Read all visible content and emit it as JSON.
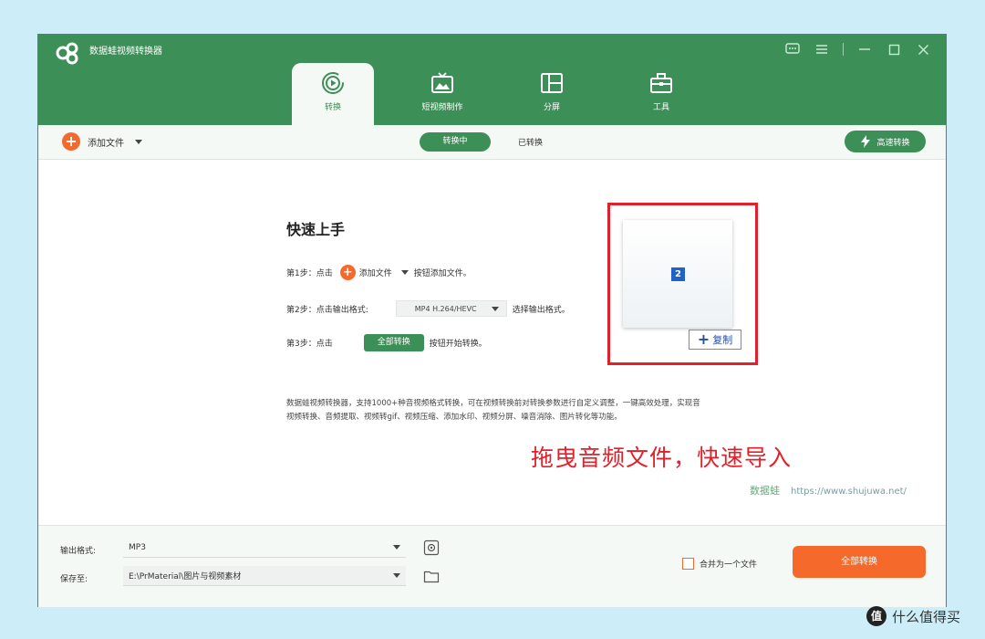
{
  "app": {
    "title": "数据蛙视频转换器"
  },
  "tabs": [
    {
      "label": "转换",
      "icon": "convert-icon",
      "active": true
    },
    {
      "label": "短视频制作",
      "icon": "tv-icon",
      "active": false
    },
    {
      "label": "分屏",
      "icon": "split-screen-icon",
      "active": false
    },
    {
      "label": "工具",
      "icon": "toolbox-icon",
      "active": false
    }
  ],
  "toolbar": {
    "add_file": "添加文件",
    "converting": "转换中",
    "converted": "已转换",
    "high_speed": "高速转换"
  },
  "guide": {
    "title": "快速上手",
    "step1_prefix": "第1步：点击",
    "step1_button": "添加文件",
    "step1_suffix": "按钮添加文件。",
    "step2_prefix": "第2步：点击输出格式:",
    "step2_format": "MP4 H.264/HEVC",
    "step2_suffix": "选择输出格式。",
    "step3_prefix": "第3步：点击",
    "step3_button": "全部转换",
    "step3_suffix": "按钮开始转换。",
    "description": "数据蛙视频转换器，支持1000+种音视频格式转换，可在视频转换前对转换参数进行自定义调整，一键高效处理，实现音视频转换、音频提取、视频转gif、视频压缩、添加水印、视频分屏、噪音消除、图片转化等功能。"
  },
  "drag": {
    "file_number": "2",
    "copy_tip": "复制",
    "copy_plus": "+",
    "caption": "拖曳音频文件，快速导入"
  },
  "watermark": {
    "brand": "数据蛙",
    "url": "https://www.shujuwa.net/"
  },
  "bottom": {
    "output_format_label": "输出格式:",
    "output_format_value": "MP3",
    "save_to_label": "保存至:",
    "save_to_value": "E:\\PrMaterial\\图片与视频素材",
    "merge_label": "合并为一个文件",
    "convert_all": "全部转换"
  },
  "site_badge": {
    "icon_text": "值",
    "text": "什么值得买"
  },
  "colors": {
    "brand_green": "#3d8f58",
    "accent_orange": "#f26a2e",
    "highlight_red": "#e3202a"
  }
}
